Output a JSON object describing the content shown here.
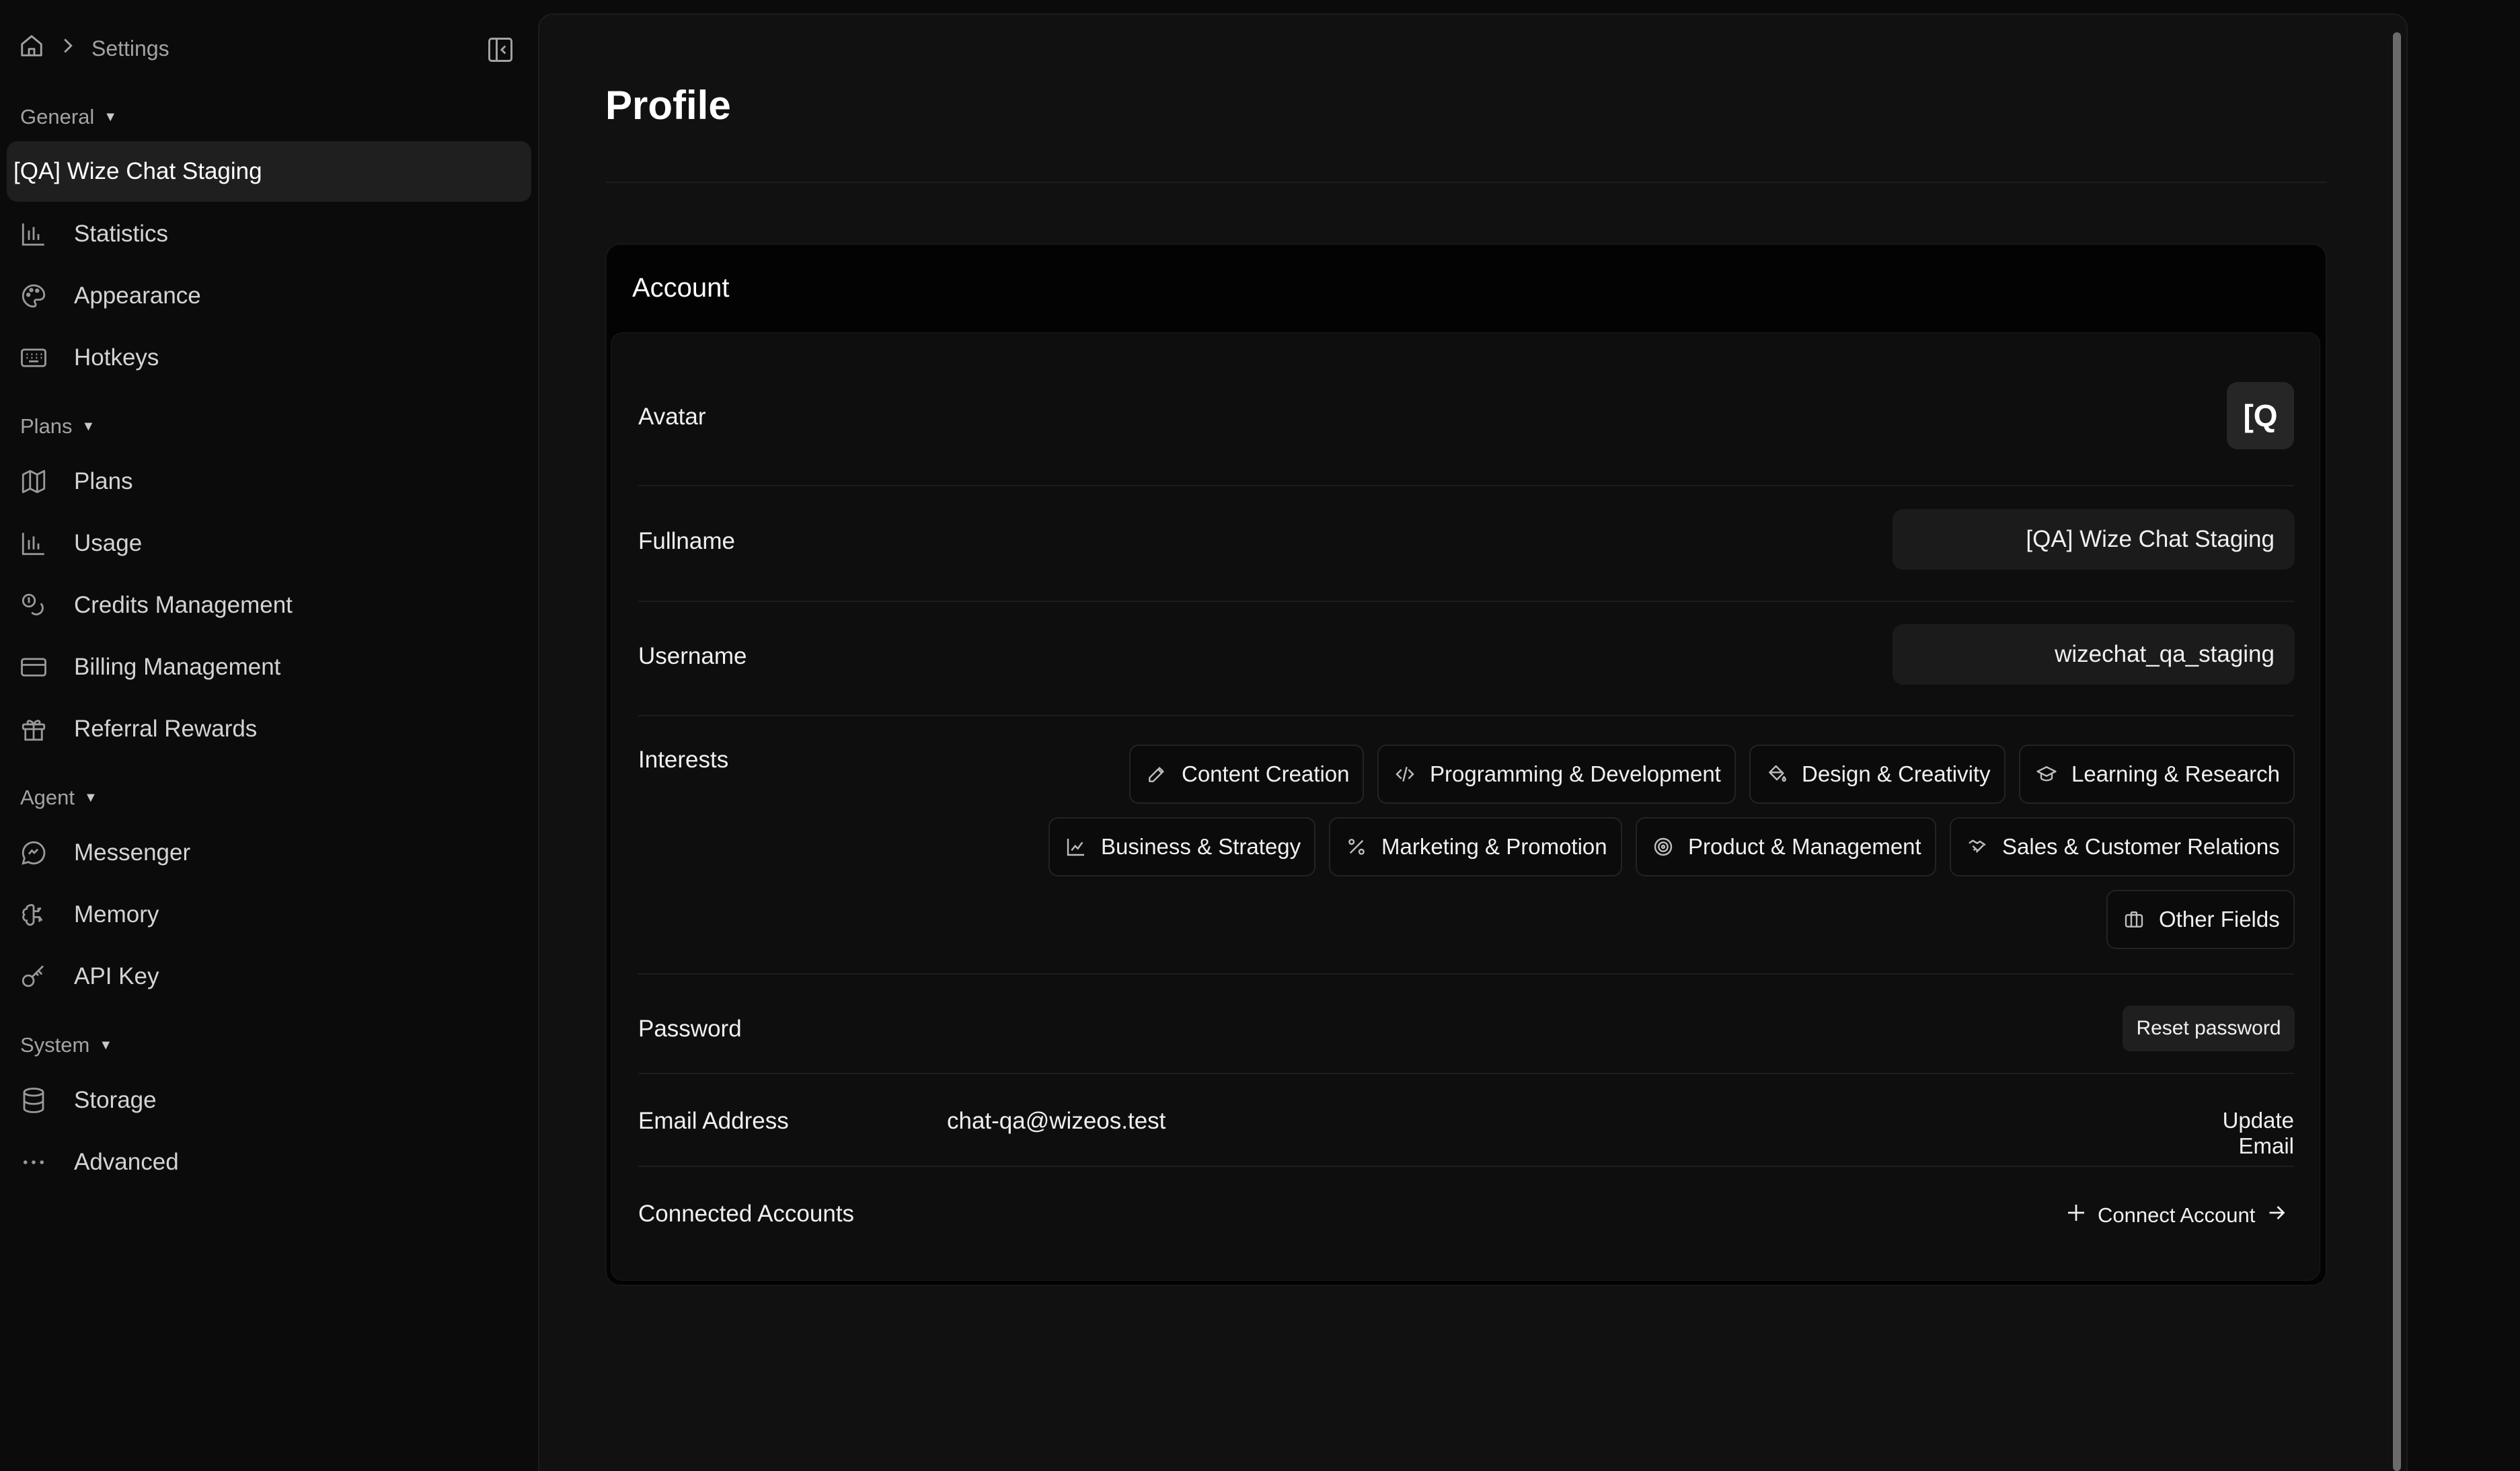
{
  "breadcrumb": {
    "current": "Settings"
  },
  "sidebar": {
    "sections": {
      "general": "General",
      "plans": "Plans",
      "agent": "Agent",
      "system": "System"
    },
    "active_workspace": "[QA] Wize Chat Staging",
    "items": {
      "statistics": "Statistics",
      "appearance": "Appearance",
      "hotkeys": "Hotkeys",
      "plans": "Plans",
      "usage": "Usage",
      "credits": "Credits Management",
      "billing": "Billing Management",
      "referral": "Referral Rewards",
      "messenger": "Messenger",
      "memory": "Memory",
      "api_key": "API Key",
      "storage": "Storage",
      "advanced": "Advanced"
    }
  },
  "main": {
    "title": "Profile",
    "account": {
      "title": "Account",
      "avatar_label": "Avatar",
      "avatar_initials": "[Q",
      "fullname_label": "Fullname",
      "fullname_value": "[QA] Wize Chat Staging",
      "username_label": "Username",
      "username_value": "wizechat_qa_staging",
      "interests_label": "Interests",
      "interests": {
        "content": "Content Creation",
        "programming": "Programming & Development",
        "design": "Design & Creativity",
        "learning": "Learning & Research",
        "business": "Business & Strategy",
        "marketing": "Marketing & Promotion",
        "product": "Product & Management",
        "sales": "Sales & Customer Relations",
        "other": "Other Fields"
      },
      "password_label": "Password",
      "reset_password": "Reset password",
      "email_label": "Email Address",
      "email_value": "chat-qa@wizeos.test",
      "update_email": "Update Email",
      "connected_label": "Connected Accounts",
      "connect_account": "Connect Account"
    }
  }
}
